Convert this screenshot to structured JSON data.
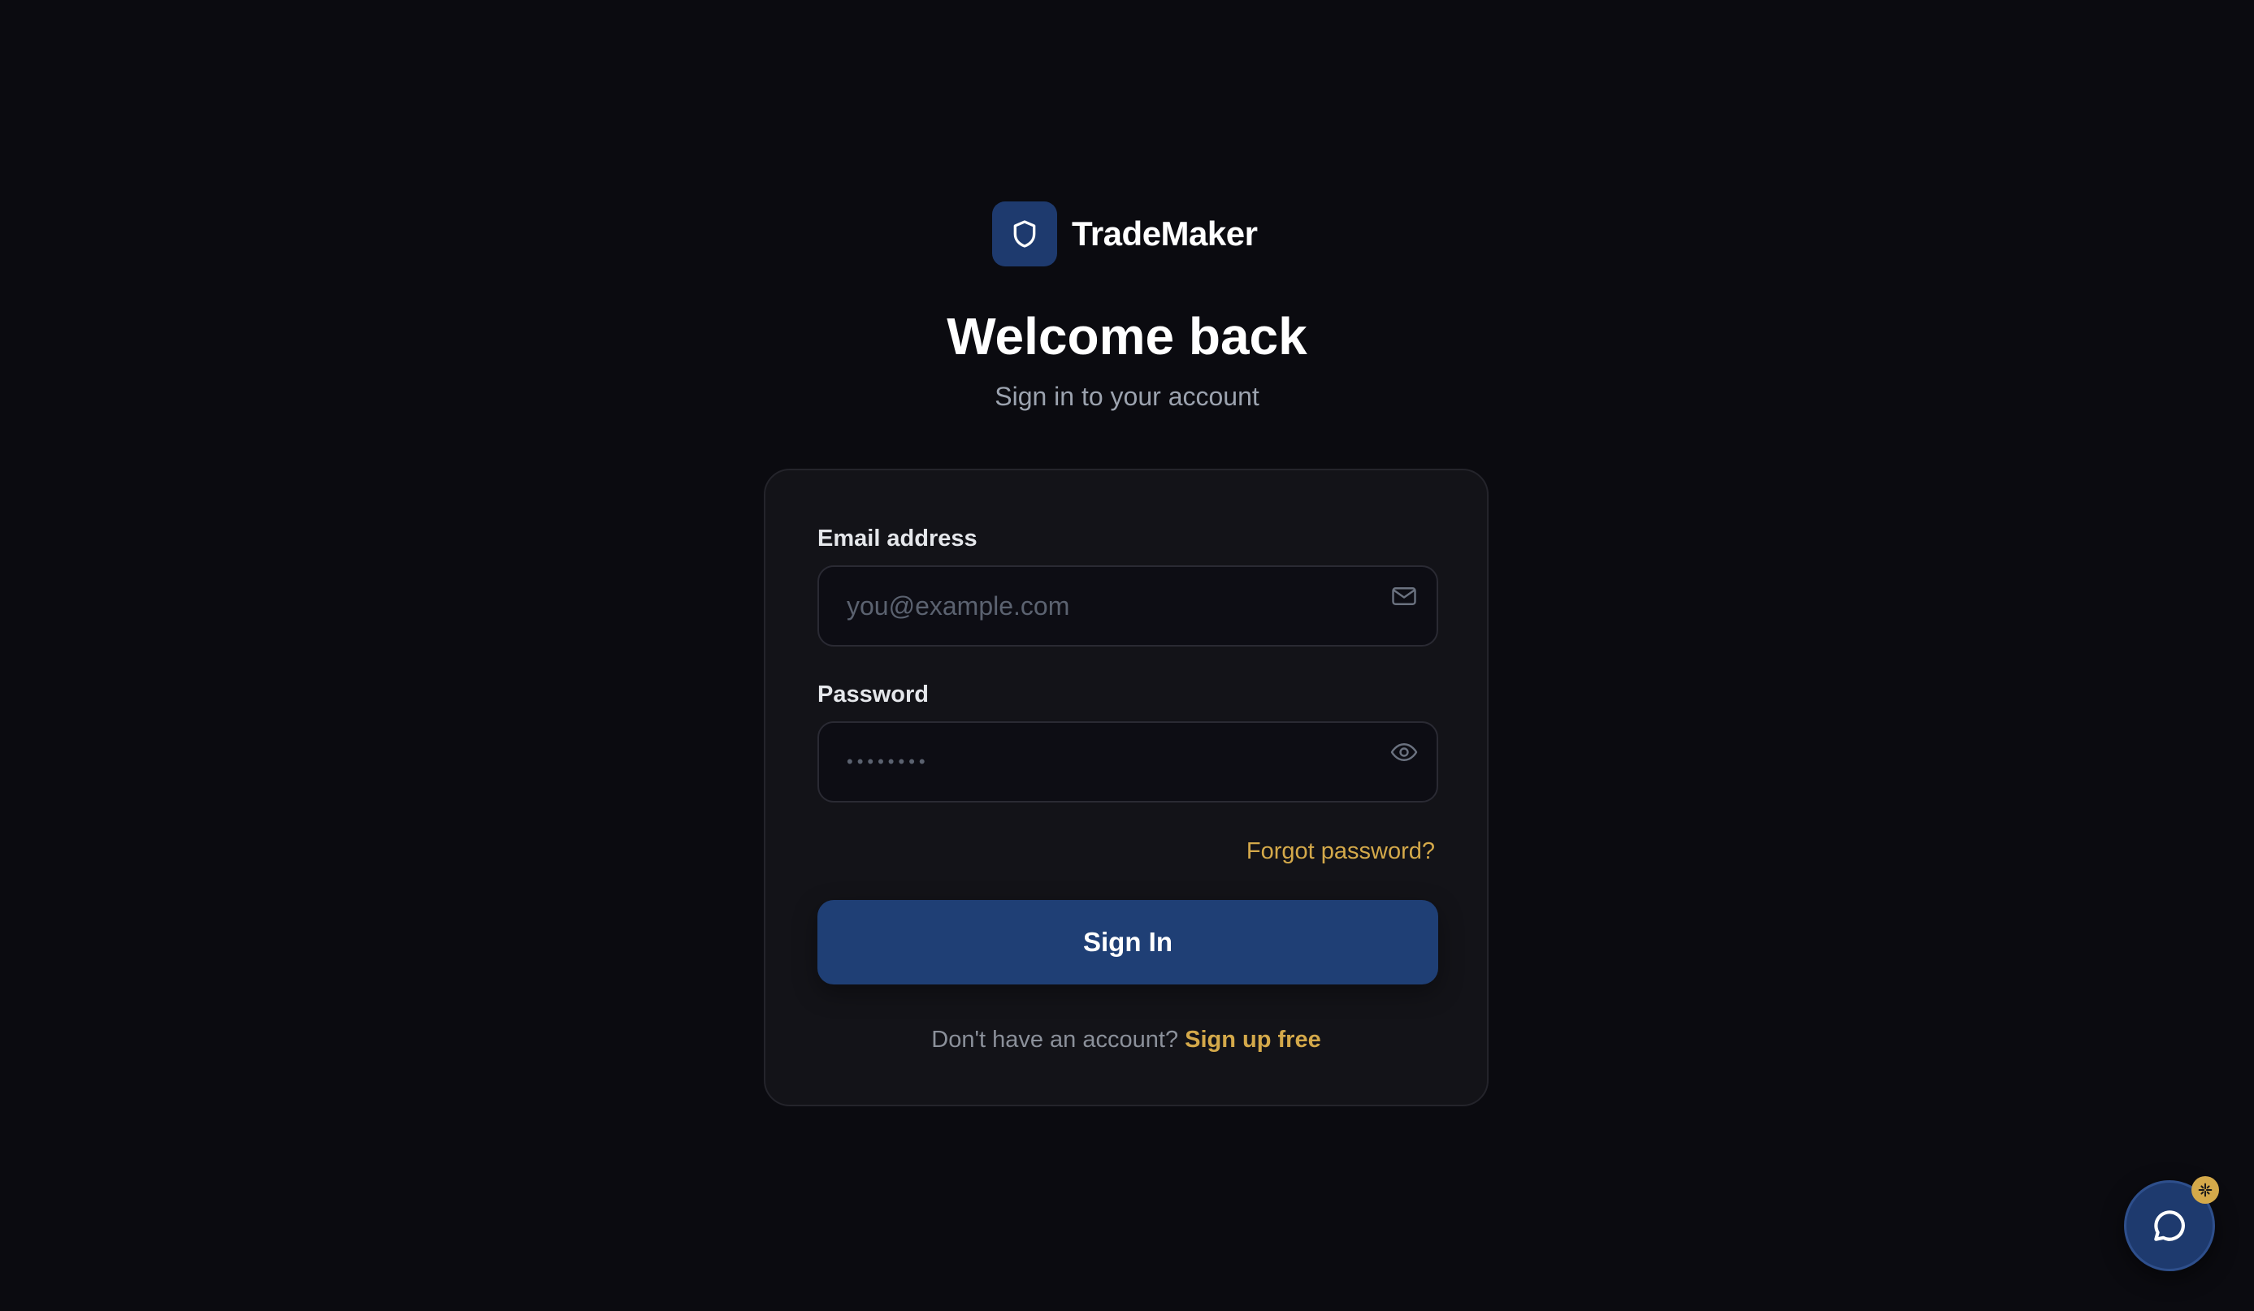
{
  "brand": {
    "name": "TradeMaker",
    "logo_icon": "shield-icon",
    "accent": "#1e3a6e"
  },
  "header": {
    "title": "Welcome back",
    "subtitle": "Sign in to your account"
  },
  "form": {
    "email": {
      "label": "Email address",
      "placeholder": "you@example.com",
      "value": "",
      "icon": "mail-icon"
    },
    "password": {
      "label": "Password",
      "masked_value": "••••••••",
      "icon": "eye-icon"
    },
    "forgot_label": "Forgot password?",
    "submit_label": "Sign In",
    "signup_prompt": "Don't have an account?",
    "signup_link": "Sign up free"
  },
  "chat_widget": {
    "icon": "chat-bubble-icon",
    "badge_icon": "sparkle-icon",
    "badge_color": "#d4a94a"
  },
  "colors": {
    "background": "#0b0b10",
    "card": "#131318",
    "primary_button": "#1f3f75",
    "link": "#d4a94a"
  }
}
